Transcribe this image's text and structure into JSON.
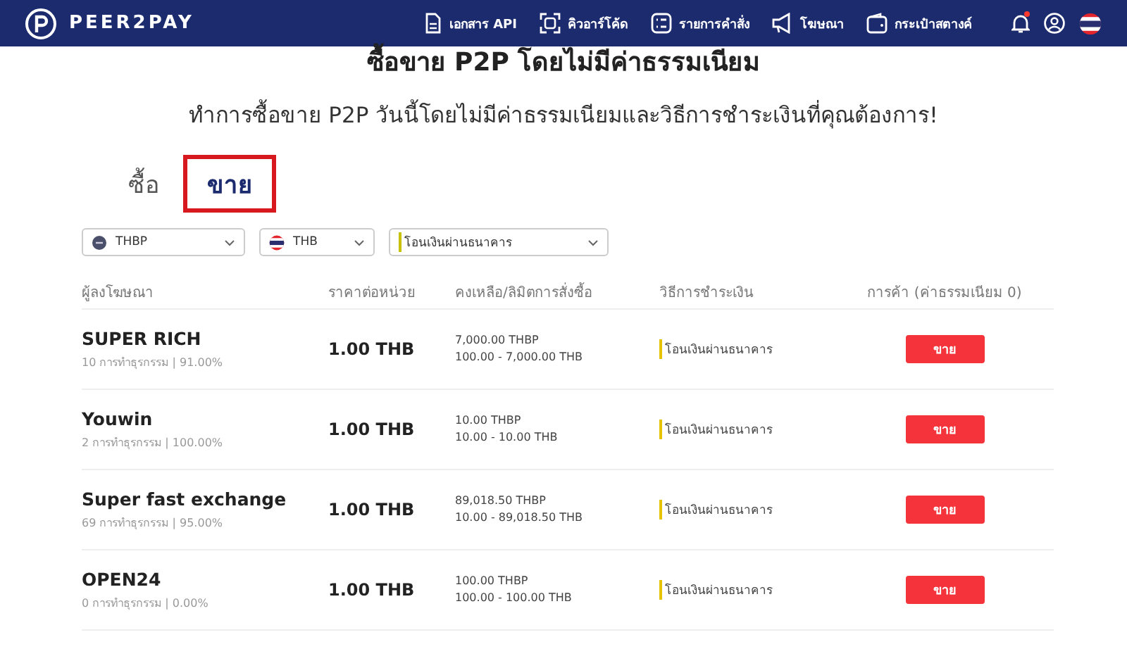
{
  "header": {
    "brand": "PEER2PAY",
    "nav": [
      "เอกสาร API",
      "คิวอาร์โค้ด",
      "รายการคำสั่ง",
      "โฆษณา",
      "กระเป๋าสตางค์"
    ],
    "notification_dot": true
  },
  "hero": {
    "title": "ซื้อขาย P2P โดยไม่มีค่าธรรมเนียม",
    "subtitle": "ทำการซื้อขาย P2P วันนี้โดยไม่มีค่าธรรมเนียมและวิธีการชำระเงินที่คุณต้องการ!"
  },
  "tabs": [
    {
      "label": "ซื้อ",
      "selected": false
    },
    {
      "label": "ขาย",
      "selected": true
    }
  ],
  "filters": [
    {
      "kind": "coin",
      "value": "THBP"
    },
    {
      "kind": "flag",
      "value": "THB"
    },
    {
      "kind": "method",
      "value": "โอนเงินผ่านธนาคาร"
    }
  ],
  "table": {
    "columns": [
      "ผู้ลงโฆษณา",
      "ราคาต่อหน่วย",
      "คงเหลือ/ลิมิตการสั่งซื้อ",
      "วิธีการชำระเงิน",
      "การค้า (ค่าธรรมเนียม 0)"
    ],
    "rows": [
      {
        "advertiser": "SUPER RICH",
        "stats": "10 การทำธุรกรรม | 91.00%",
        "price": "1.00 THB",
        "available": "7,000.00 THBP",
        "limit": "100.00 - 7,000.00 THB",
        "method": "โอนเงินผ่านธนาคาร",
        "action": "ขาย"
      },
      {
        "advertiser": "Youwin",
        "stats": "2 การทำธุรกรรม | 100.00%",
        "price": "1.00 THB",
        "available": "10.00 THBP",
        "limit": "10.00 - 10.00 THB",
        "method": "โอนเงินผ่านธนาคาร",
        "action": "ขาย"
      },
      {
        "advertiser": "Super fast exchange",
        "stats": "69 การทำธุรกรรม | 95.00%",
        "price": "1.00 THB",
        "available": "89,018.50 THBP",
        "limit": "10.00 - 89,018.50 THB",
        "method": "โอนเงินผ่านธนาคาร",
        "action": "ขาย"
      },
      {
        "advertiser": "OPEN24",
        "stats": "0 การทำธุรกรรม | 0.00%",
        "price": "1.00 THB",
        "available": "100.00 THBP",
        "limit": "100.00 - 100.00 THB",
        "method": "โอนเงินผ่านธนาคาร",
        "action": "ขาย"
      }
    ]
  }
}
